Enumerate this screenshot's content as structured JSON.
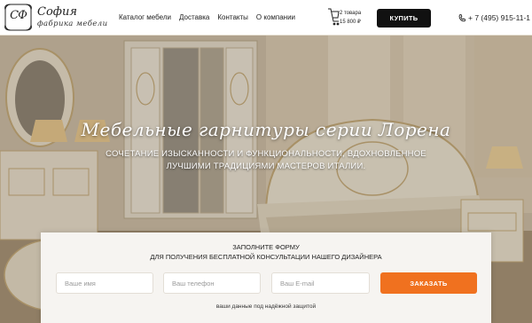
{
  "header": {
    "logo": {
      "mark": "СФ",
      "name": "София",
      "tagline": "фабрика мебели"
    },
    "nav": [
      {
        "label": "Каталог мебели"
      },
      {
        "label": "Доставка"
      },
      {
        "label": "Контакты"
      },
      {
        "label": "О компании"
      }
    ],
    "cart": {
      "count": "2 товара",
      "sum": "15 800 ₽",
      "icon": "cart-icon"
    },
    "buy_label": "КУПИТЬ",
    "phone": {
      "number": "+ 7 (495) 915-11-1",
      "icon": "phone-icon"
    }
  },
  "hero": {
    "title": "Мебельные гарнитуры серии Лорена",
    "subtitle": "Сочетание изысканности и функциональности, вдохновленное лучшими традициями мастеров Италии."
  },
  "form": {
    "title_line1": "Заполните форму",
    "title_line2": "для получения бесплатной консультации нашего дизайнера",
    "name_placeholder": "Ваше имя",
    "phone_placeholder": "Ваш телефон",
    "email_placeholder": "Ваш E-mail",
    "submit_label": "ЗАКАЗАТЬ",
    "note": "ваши данные под надёжной защитой"
  },
  "colors": {
    "accent": "#f0711f",
    "buy_button": "#111111",
    "panel": "#f6f4f1"
  }
}
